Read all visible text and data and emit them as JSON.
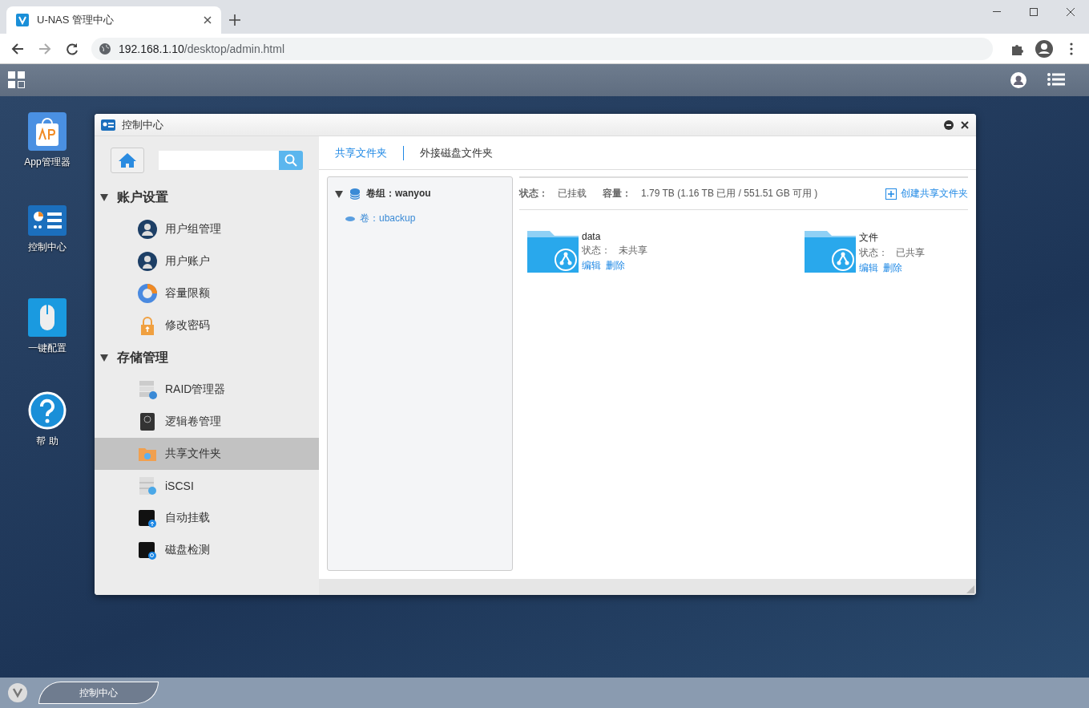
{
  "browser": {
    "tab_title": "U-NAS 管理中心",
    "url_host": "192.168.1.10",
    "url_path": "/desktop/admin.html"
  },
  "desktop_icons": [
    {
      "label": "App管理器",
      "kind": "app"
    },
    {
      "label": "控制中心",
      "kind": "control"
    },
    {
      "label": "一键配置",
      "kind": "mouse"
    },
    {
      "label": "帮 助",
      "kind": "help"
    }
  ],
  "window": {
    "title": "控制中心",
    "sidebar": [
      {
        "title": "账户设置",
        "expanded": true,
        "items": [
          {
            "label": "用户组管理",
            "kind": "user-group",
            "selected": false
          },
          {
            "label": "用户账户",
            "kind": "user",
            "selected": false
          },
          {
            "label": "容量限额",
            "kind": "pie",
            "selected": false
          },
          {
            "label": "修改密码",
            "kind": "lock",
            "selected": false
          }
        ]
      },
      {
        "title": "存储管理",
        "expanded": true,
        "items": [
          {
            "label": "RAID管理器",
            "kind": "raid",
            "selected": false
          },
          {
            "label": "逻辑卷管理",
            "kind": "lvm",
            "selected": false
          },
          {
            "label": "共享文件夹",
            "kind": "folder",
            "selected": true
          },
          {
            "label": "iSCSI",
            "kind": "iscsi",
            "selected": false
          },
          {
            "label": "自动挂载",
            "kind": "mount",
            "selected": false
          },
          {
            "label": "磁盘检测",
            "kind": "disk-check",
            "selected": false
          }
        ]
      }
    ],
    "tabs": [
      {
        "label": "共享文件夹",
        "selected": true
      },
      {
        "label": "外接磁盘文件夹",
        "selected": false
      }
    ],
    "tree": {
      "label": "卷组：wanyou",
      "expanded": true,
      "children": [
        {
          "label": "卷：ubackup"
        }
      ]
    },
    "status_label": "状态：",
    "status": "已挂载",
    "capacity_label": "容量：",
    "capacity": "1.79 TB (1.16 TB 已用 / 551.51 GB 可用 )",
    "create_button": "创建共享文件夹",
    "folders": [
      {
        "name": "data",
        "status_label": "状态：",
        "status": "未共享",
        "actions": [
          "编辑",
          "删除"
        ]
      },
      {
        "name": "文件",
        "status_label": "状态：",
        "status": "已共享",
        "actions": [
          "编辑",
          "删除"
        ]
      }
    ]
  },
  "taskbar": {
    "items": [
      {
        "label": "控制中心"
      }
    ]
  }
}
